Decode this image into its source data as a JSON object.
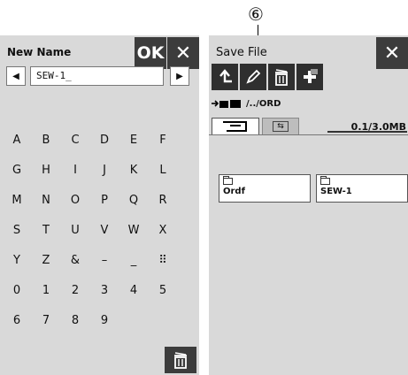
{
  "callout": {
    "number": "⑥"
  },
  "new_name_screen": {
    "title": "New Name",
    "ok_label": "OK",
    "close_glyph": "✕",
    "left_arrow": "◀",
    "right_arrow": "▶",
    "name_value": "SEW-1_",
    "keys": [
      [
        "A",
        "B",
        "C",
        "D",
        "E",
        "F"
      ],
      [
        "G",
        "H",
        "I",
        "J",
        "K",
        "L"
      ],
      [
        "M",
        "N",
        "O",
        "P",
        "Q",
        "R"
      ],
      [
        "S",
        "T",
        "U",
        "V",
        "W",
        "X"
      ],
      [
        "Y",
        "Z",
        "&",
        "–",
        "_",
        "⠿"
      ],
      [
        "0",
        "1",
        "2",
        "3",
        "4",
        "5"
      ],
      [
        "6",
        "7",
        "8",
        "9"
      ]
    ]
  },
  "save_file_screen": {
    "title": "Save File",
    "close_glyph": "✕",
    "path_text": "/../ORD",
    "usb_icon_text": "⇆",
    "capacity": "0.1/3.0MB",
    "folders": [
      {
        "name": "Ordf"
      },
      {
        "name": "SEW-1"
      }
    ]
  }
}
